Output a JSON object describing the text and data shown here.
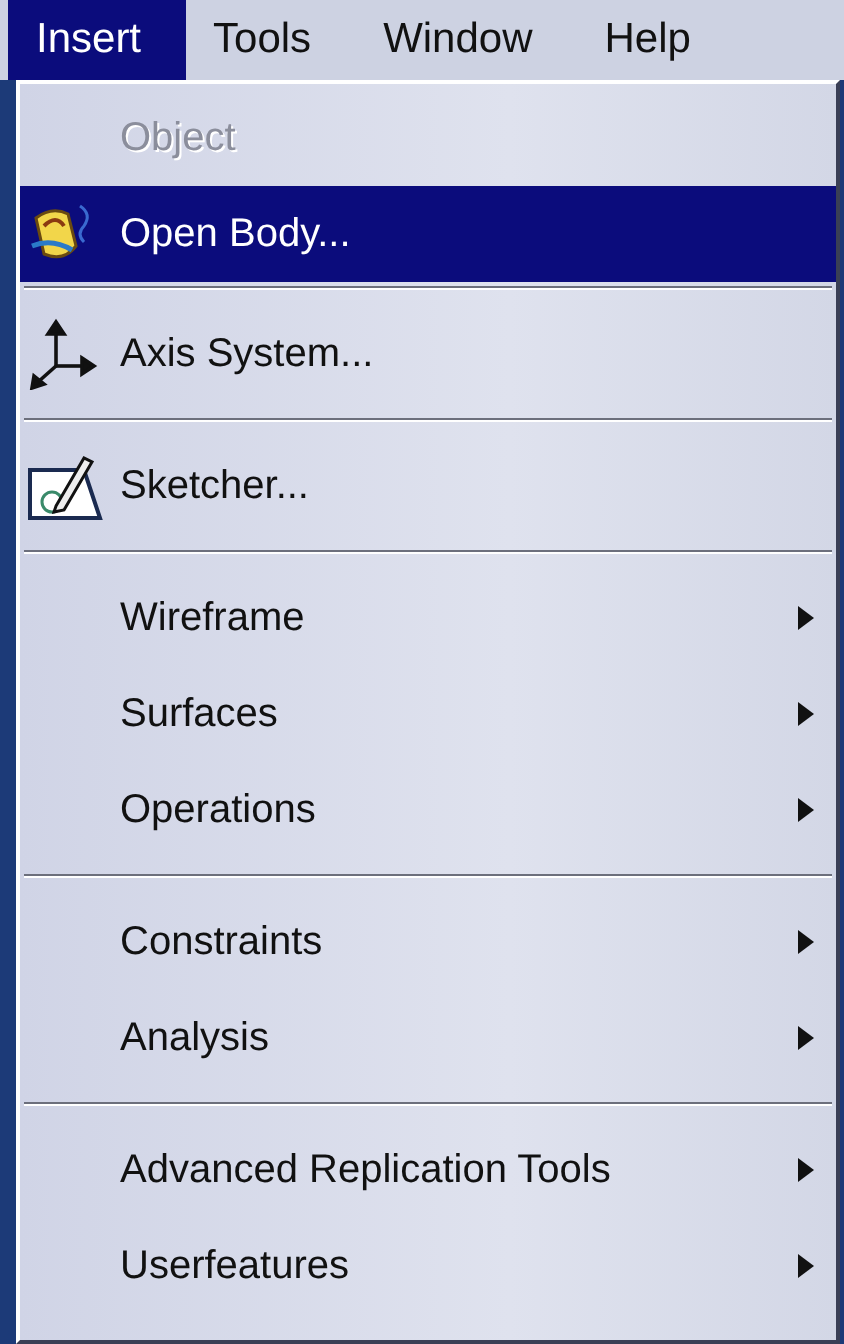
{
  "menubar": [
    {
      "label": "Insert",
      "selected": true
    },
    {
      "label": "Tools",
      "selected": false
    },
    {
      "label": "Window",
      "selected": false
    },
    {
      "label": "Help",
      "selected": false
    }
  ],
  "menu": {
    "groups": [
      {
        "items": [
          {
            "kind": "plain",
            "label": "Object",
            "disabled": true,
            "selected": false,
            "submenu": false
          },
          {
            "kind": "body",
            "label": "Open Body...",
            "disabled": false,
            "selected": true,
            "submenu": false
          }
        ]
      },
      {
        "items": [
          {
            "kind": "axis",
            "label": "Axis System...",
            "disabled": false,
            "selected": false,
            "submenu": false
          }
        ]
      },
      {
        "items": [
          {
            "kind": "sketch",
            "label": "Sketcher...",
            "disabled": false,
            "selected": false,
            "submenu": false
          }
        ]
      },
      {
        "items": [
          {
            "kind": "plain",
            "label": "Wireframe",
            "disabled": false,
            "selected": false,
            "submenu": true
          },
          {
            "kind": "plain",
            "label": "Surfaces",
            "disabled": false,
            "selected": false,
            "submenu": true
          },
          {
            "kind": "plain",
            "label": "Operations",
            "disabled": false,
            "selected": false,
            "submenu": true
          }
        ]
      },
      {
        "items": [
          {
            "kind": "plain",
            "label": "Constraints",
            "disabled": false,
            "selected": false,
            "submenu": true
          },
          {
            "kind": "plain",
            "label": "Analysis",
            "disabled": false,
            "selected": false,
            "submenu": true
          }
        ]
      },
      {
        "items": [
          {
            "kind": "plain",
            "label": "Advanced Replication Tools",
            "disabled": false,
            "selected": false,
            "submenu": true
          },
          {
            "kind": "plain",
            "label": "Userfeatures",
            "disabled": false,
            "selected": false,
            "submenu": true
          }
        ]
      }
    ]
  }
}
